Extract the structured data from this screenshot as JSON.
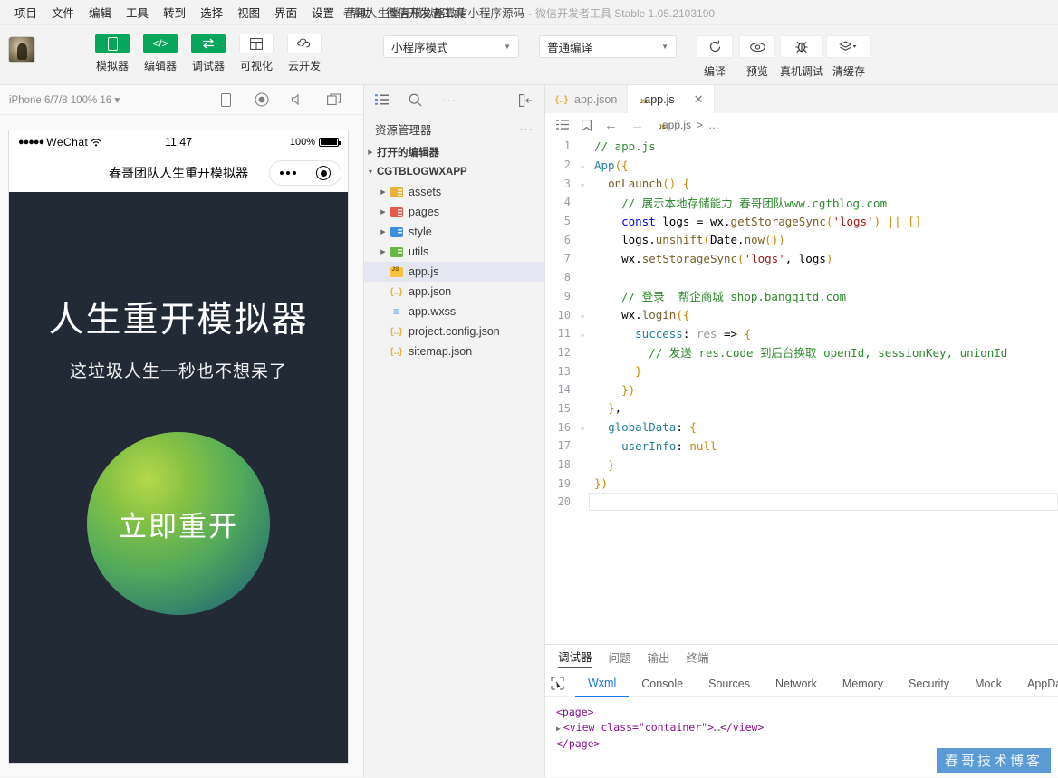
{
  "window": {
    "title_main": "春哥人生重开模拟器微信小程序源码",
    "title_dash": "-",
    "title_app": "微信开发者工具 Stable 1.05.2103190"
  },
  "menubar": {
    "items": [
      {
        "label": "项目"
      },
      {
        "label": "文件"
      },
      {
        "label": "编辑"
      },
      {
        "label": "工具"
      },
      {
        "label": "转到"
      },
      {
        "label": "选择"
      },
      {
        "label": "视图"
      },
      {
        "label": "界面"
      },
      {
        "label": "设置"
      },
      {
        "label": "帮助"
      },
      {
        "label": "微信开发者工具"
      }
    ]
  },
  "toolbar": {
    "buttons": [
      {
        "label": "模拟器",
        "icon": "phone-icon",
        "style": "green"
      },
      {
        "label": "编辑器",
        "icon": "code-icon",
        "style": "green"
      },
      {
        "label": "调试器",
        "icon": "swap-icon",
        "style": "green"
      },
      {
        "label": "可视化",
        "icon": "layout-icon",
        "style": "white"
      },
      {
        "label": "云开发",
        "icon": "cloud-icon",
        "style": "white"
      }
    ],
    "mode_select": {
      "value": "小程序模式"
    },
    "compile_select": {
      "value": "普通编译"
    },
    "actions": [
      {
        "label": "编译",
        "icon": "refresh-icon"
      },
      {
        "label": "预览",
        "icon": "eye-icon"
      },
      {
        "label": "真机调试",
        "icon": "bug-icon"
      },
      {
        "label": "清缓存",
        "icon": "layers-icon"
      }
    ]
  },
  "simulator": {
    "device_label": "iPhone 6/7/8 100% 16",
    "head_icons": [
      "phone-rotate-icon",
      "record-icon",
      "mute-icon",
      "window-icon"
    ],
    "status_bar": {
      "carrier": "WeChat",
      "dots": "●●●●●",
      "time": "11:47",
      "battery_text": "100%"
    },
    "nav_title": "春哥团队人生重开模拟器",
    "page": {
      "title": "人生重开模拟器",
      "subtitle": "这垃圾人生一秒也不想呆了",
      "button": "立即重开"
    }
  },
  "explorer": {
    "toolbar_icons": [
      "list-icon",
      "search-icon",
      "more-icon",
      "collapse-panel-icon"
    ],
    "title": "资源管理器",
    "more": "···",
    "sections": [
      {
        "label": "打开的编辑器",
        "expanded": false
      },
      {
        "label": "CGTBLOGWXAPP",
        "expanded": true
      }
    ],
    "tree": [
      {
        "name": "assets",
        "type": "folder",
        "color": "#e8b43c",
        "indent": 1
      },
      {
        "name": "pages",
        "type": "folder",
        "color": "#e05b4a",
        "indent": 1
      },
      {
        "name": "style",
        "type": "folder",
        "color": "#3e8ee0",
        "indent": 1
      },
      {
        "name": "utils",
        "type": "folder",
        "color": "#69b844",
        "indent": 1
      },
      {
        "name": "app.js",
        "type": "js",
        "indent": 2,
        "selected": true
      },
      {
        "name": "app.json",
        "type": "json",
        "indent": 2
      },
      {
        "name": "app.wxss",
        "type": "wxss",
        "indent": 2
      },
      {
        "name": "project.config.json",
        "type": "json",
        "indent": 2
      },
      {
        "name": "sitemap.json",
        "type": "json",
        "indent": 2
      }
    ]
  },
  "editor": {
    "tabs": [
      {
        "label": "app.json",
        "type": "json",
        "active": false
      },
      {
        "label": "app.js",
        "type": "js",
        "active": true,
        "close": "✕"
      }
    ],
    "breadcrumb": {
      "file": "app.js",
      "sep": ">",
      "rest": "…"
    },
    "bc_icons": [
      "outline-icon",
      "bookmark-icon",
      "back-arrow-icon",
      "forward-arrow-icon"
    ],
    "lines": [
      {
        "n": "1",
        "fold": "",
        "code": "// app.js",
        "kind": "comment"
      },
      {
        "n": "2",
        "fold": "v",
        "code": "App({"
      },
      {
        "n": "3",
        "fold": "v",
        "code": "  onLaunch() {"
      },
      {
        "n": "4",
        "fold": "",
        "code": "    // 展示本地存储能力 春哥团队www.cgtblog.com",
        "kind": "comment"
      },
      {
        "n": "5",
        "fold": "",
        "code": "    const logs = wx.getStorageSync('logs') || []"
      },
      {
        "n": "6",
        "fold": "",
        "code": "    logs.unshift(Date.now())"
      },
      {
        "n": "7",
        "fold": "",
        "code": "    wx.setStorageSync('logs', logs)"
      },
      {
        "n": "8",
        "fold": "",
        "code": ""
      },
      {
        "n": "9",
        "fold": "",
        "code": "    // 登录  帮企商城 shop.bangqitd.com",
        "kind": "comment"
      },
      {
        "n": "10",
        "fold": "v",
        "code": "    wx.login({"
      },
      {
        "n": "11",
        "fold": "v",
        "code": "      success: res => {"
      },
      {
        "n": "12",
        "fold": "",
        "code": "        // 发送 res.code 到后台换取 openId, sessionKey, unionId",
        "kind": "comment"
      },
      {
        "n": "13",
        "fold": "",
        "code": "      }"
      },
      {
        "n": "14",
        "fold": "",
        "code": "    })"
      },
      {
        "n": "15",
        "fold": "",
        "code": "  },"
      },
      {
        "n": "16",
        "fold": "v",
        "code": "  globalData: {"
      },
      {
        "n": "17",
        "fold": "",
        "code": "    userInfo: null"
      },
      {
        "n": "18",
        "fold": "",
        "code": "  }"
      },
      {
        "n": "19",
        "fold": "",
        "code": "})"
      },
      {
        "n": "20",
        "fold": "",
        "code": ""
      }
    ]
  },
  "debugger": {
    "panel_tabs": [
      {
        "label": "调试器",
        "active": true
      },
      {
        "label": "问题",
        "active": false
      },
      {
        "label": "输出",
        "active": false
      },
      {
        "label": "终端",
        "active": false
      }
    ],
    "devtool_tabs": [
      {
        "label": "Wxml",
        "active": true
      },
      {
        "label": "Console",
        "active": false
      },
      {
        "label": "Sources",
        "active": false
      },
      {
        "label": "Network",
        "active": false
      },
      {
        "label": "Memory",
        "active": false
      },
      {
        "label": "Security",
        "active": false
      },
      {
        "label": "Mock",
        "active": false
      },
      {
        "label": "AppData",
        "active": false
      }
    ],
    "wxml": {
      "line1": "<page>",
      "line2_open": "<view class=\"container\">",
      "line2_ellipsis": "…",
      "line2_close": "</view>",
      "line3": "</page>"
    }
  },
  "watermark": {
    "text": "春哥技术博客",
    "color": "#5b9bd5"
  }
}
